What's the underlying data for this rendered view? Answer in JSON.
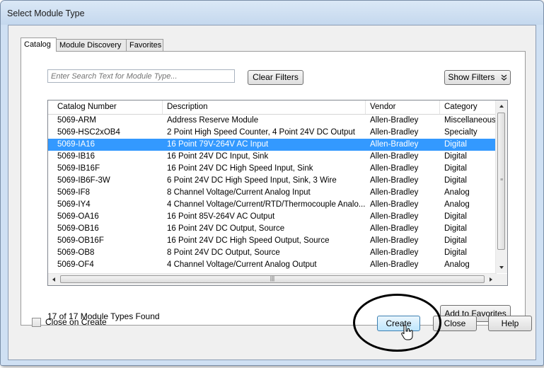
{
  "window": {
    "title": "Select Module Type"
  },
  "tabs": [
    {
      "label": "Catalog",
      "active": true
    },
    {
      "label": "Module Discovery",
      "active": false
    },
    {
      "label": "Favorites",
      "active": false
    }
  ],
  "search": {
    "placeholder": "Enter Search Text for Module Type...",
    "value": ""
  },
  "buttons": {
    "clear_filters": "Clear Filters",
    "show_filters": "Show Filters",
    "show_filters_icon": "double-chevron-down-icon",
    "add_to_favorites": "Add to Favorites",
    "create": "Create",
    "close": "Close",
    "help": "Help"
  },
  "grid": {
    "columns": [
      "Catalog Number",
      "Description",
      "Vendor",
      "Category"
    ],
    "selected_row": 2,
    "rows": [
      [
        "5069-ARM",
        "Address Reserve Module",
        "Allen-Bradley",
        "Miscellaneous"
      ],
      [
        "5069-HSC2xOB4",
        "2 Point High Speed Counter, 4 Point 24V DC Output",
        "Allen-Bradley",
        "Specialty"
      ],
      [
        "5069-IA16",
        "16 Point 79V-264V AC Input",
        "Allen-Bradley",
        "Digital"
      ],
      [
        "5069-IB16",
        "16 Point 24V DC Input, Sink",
        "Allen-Bradley",
        "Digital"
      ],
      [
        "5069-IB16F",
        "16 Point 24V DC High Speed Input, Sink",
        "Allen-Bradley",
        "Digital"
      ],
      [
        "5069-IB6F-3W",
        "6 Point 24V DC High Speed Input, Sink, 3 Wire",
        "Allen-Bradley",
        "Digital"
      ],
      [
        "5069-IF8",
        "8 Channel Voltage/Current Analog Input",
        "Allen-Bradley",
        "Analog"
      ],
      [
        "5069-IY4",
        "4 Channel Voltage/Current/RTD/Thermocouple Analo...",
        "Allen-Bradley",
        "Analog"
      ],
      [
        "5069-OA16",
        "16 Point 85V-264V AC Output",
        "Allen-Bradley",
        "Digital"
      ],
      [
        "5069-OB16",
        "16 Point 24V DC Output, Source",
        "Allen-Bradley",
        "Digital"
      ],
      [
        "5069-OB16F",
        "16 Point 24V DC High Speed Output, Source",
        "Allen-Bradley",
        "Digital"
      ],
      [
        "5069-OB8",
        "8 Point 24V DC Output, Source",
        "Allen-Bradley",
        "Digital"
      ],
      [
        "5069-OF4",
        "4 Channel Voltage/Current Analog Output",
        "Allen-Bradley",
        "Analog"
      ]
    ]
  },
  "status": {
    "count_text": "17 of 17 Module Types Found"
  },
  "options": {
    "close_on_create_label": "Close on Create",
    "close_on_create_checked": false
  },
  "colors": {
    "selection": "#3399ff",
    "annotation_circle": "#000000"
  },
  "icons": {
    "scroll_up": "scroll-up-arrow-icon",
    "scroll_down": "scroll-down-arrow-icon",
    "scroll_left": "scroll-left-arrow-icon",
    "scroll_right": "scroll-right-arrow-icon",
    "pointer": "mouse-pointer-icon"
  }
}
